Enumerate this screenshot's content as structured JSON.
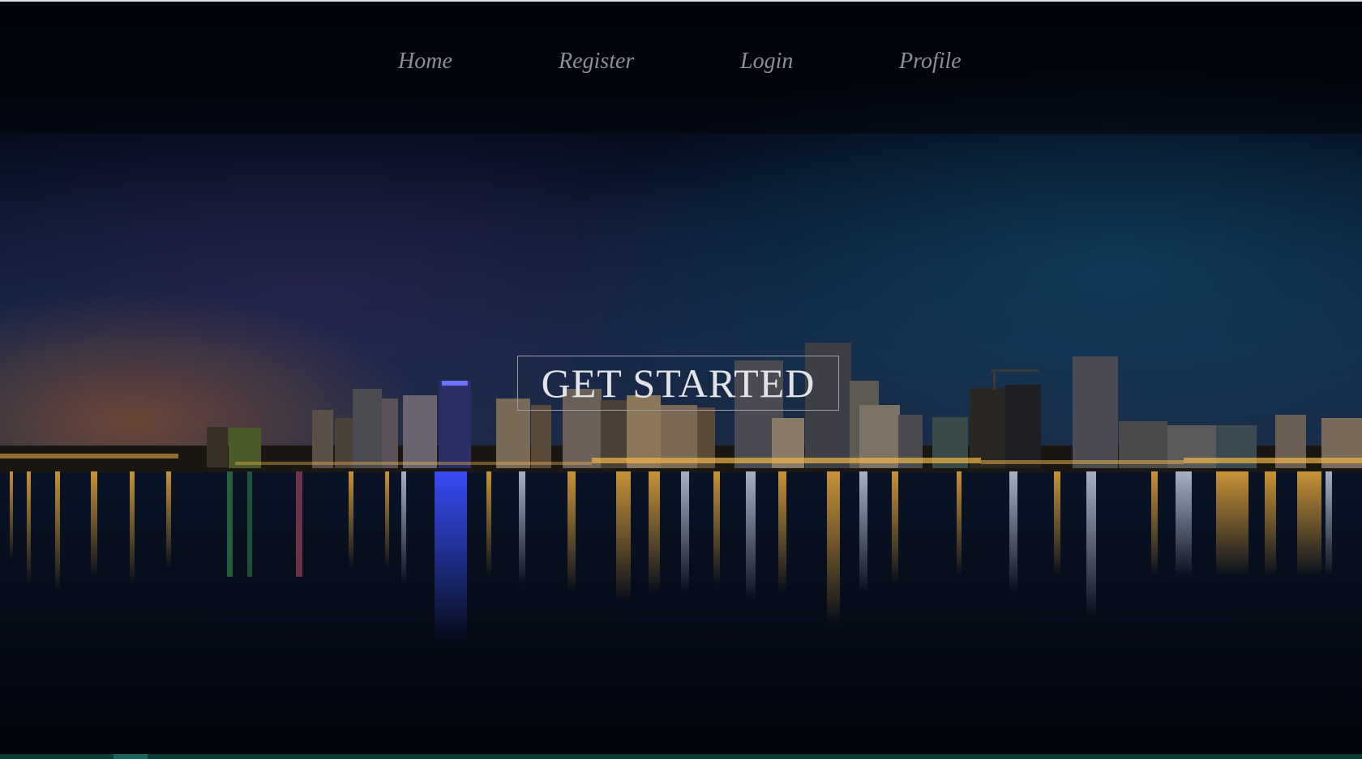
{
  "nav": {
    "items": [
      {
        "label": "Home"
      },
      {
        "label": "Register"
      },
      {
        "label": "Login"
      },
      {
        "label": "Profile"
      }
    ]
  },
  "hero": {
    "cta_label": "GET STARTED",
    "background": "night city skyline reflected on water"
  },
  "colors": {
    "nav_text": "#8d8f96",
    "cta_text": "#e2e3e6",
    "cta_border": "#9a9ca2",
    "background": "#02040b"
  }
}
